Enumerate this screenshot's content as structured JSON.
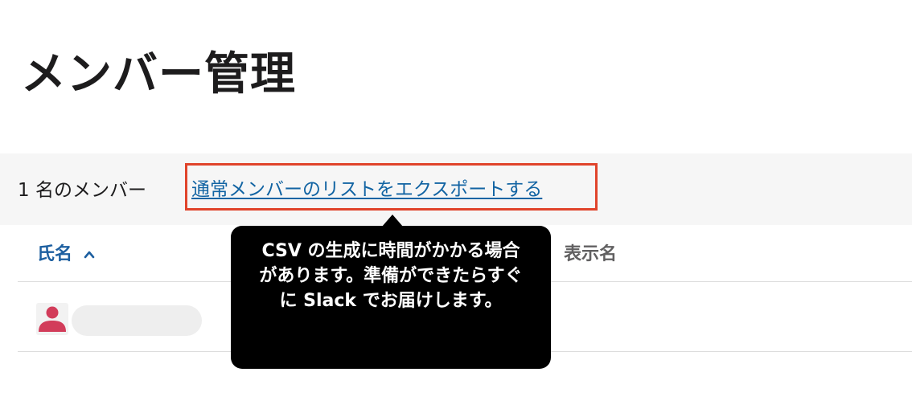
{
  "page": {
    "title": "メンバー管理"
  },
  "toolbar": {
    "member_count": "1 名のメンバー",
    "export_link": "通常メンバーのリストをエクスポートする"
  },
  "table": {
    "columns": [
      {
        "label": "氏名",
        "sort": "ascending"
      },
      {
        "label": "表示名"
      }
    ],
    "rows": [
      {
        "avatar": "person-icon"
      }
    ]
  },
  "tooltip": {
    "text": "CSV の生成に時間がかかる場合があります。準備ができたらすぐに Slack でお届けします。"
  },
  "colors": {
    "highlight_border": "#e0442b",
    "link": "#1264a3",
    "avatar": "#d23c5a"
  }
}
